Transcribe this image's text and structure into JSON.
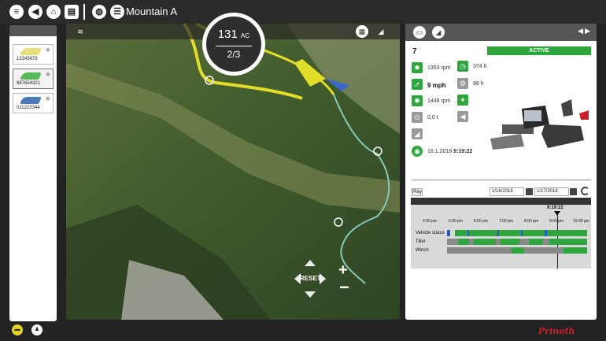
{
  "app": {
    "title": "Mountain A"
  },
  "topbar": {
    "icons": [
      "menu-icon",
      "back-icon",
      "home-icon",
      "report-icon",
      "globe-icon",
      "list-icon"
    ]
  },
  "fleet": {
    "vehicles": [
      {
        "id": "12345678",
        "color": "#e6e07a"
      },
      {
        "id": "987654321",
        "color": "#59b85a"
      },
      {
        "id": "011223344",
        "color": "#4b79b8"
      }
    ]
  },
  "gauge": {
    "value": "131",
    "unit": "AC",
    "fraction_num": "2",
    "fraction_den": "3"
  },
  "map": {
    "reset_label": "RESET"
  },
  "detail": {
    "vehicle_id": "7",
    "status": "ACTIVE",
    "metrics": {
      "rpm1": "1353 rpm",
      "hours1": "374 h",
      "speed": "9 mph",
      "hours2": "98 h",
      "rpm2": "1448 rpm",
      "load": "0,0 t",
      "timestamp_date": "16.1.2018",
      "timestamp_time": "9:19:22"
    }
  },
  "timeline": {
    "play_label": "Play",
    "date_from": "1/16/2018",
    "date_to": "1/17/2018",
    "cursor_label": "9:19:22",
    "ticks": [
      "4:00 pm",
      "5:00 pm",
      "6:00 pm",
      "7:00 pm",
      "8:00 pm",
      "9:00 pm",
      "10:00 pm"
    ],
    "rows": [
      "Vehicle status",
      "Tiller",
      "Winch"
    ]
  },
  "brand": {
    "logo": "Prinoth",
    "accent": "#2fa53d"
  }
}
